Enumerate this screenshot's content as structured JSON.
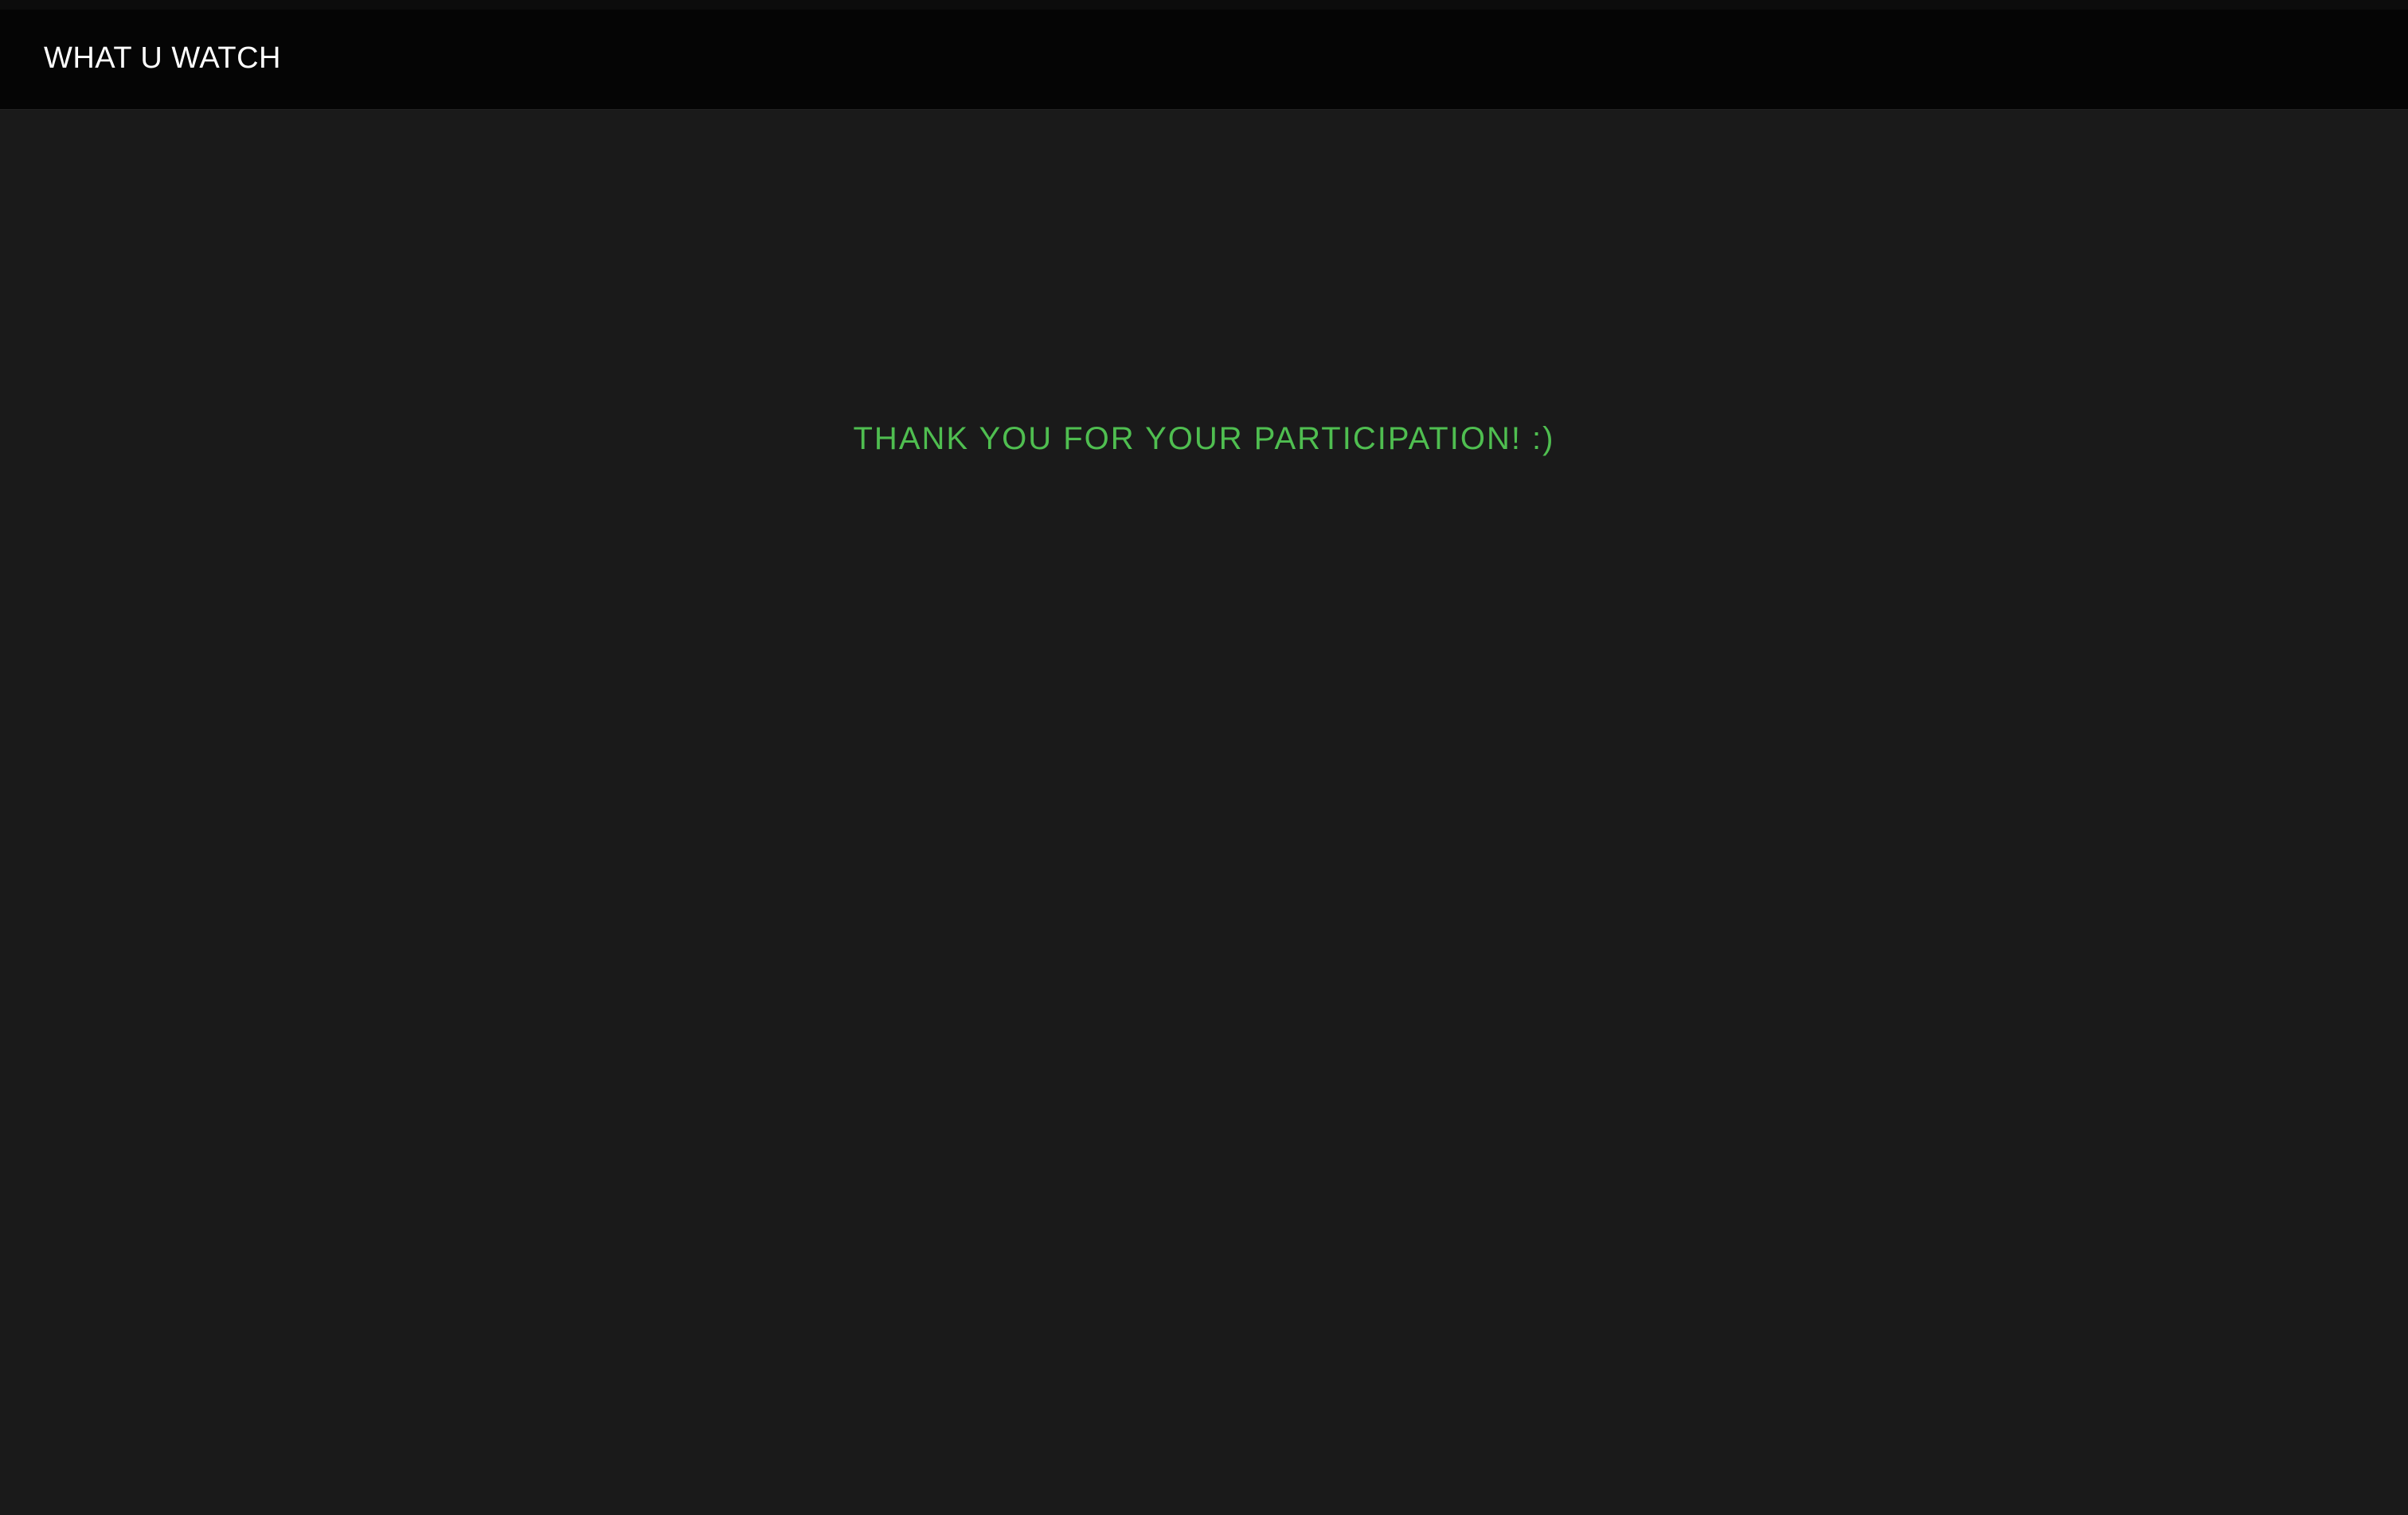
{
  "header": {
    "brand": "WHAT U WATCH"
  },
  "main": {
    "message": "THANK YOU FOR YOUR PARTICIPATION! :)"
  },
  "colors": {
    "background": "#1a1a1a",
    "header_background": "#050505",
    "brand_text": "#ffffff",
    "accent_green": "#4fbe50"
  }
}
